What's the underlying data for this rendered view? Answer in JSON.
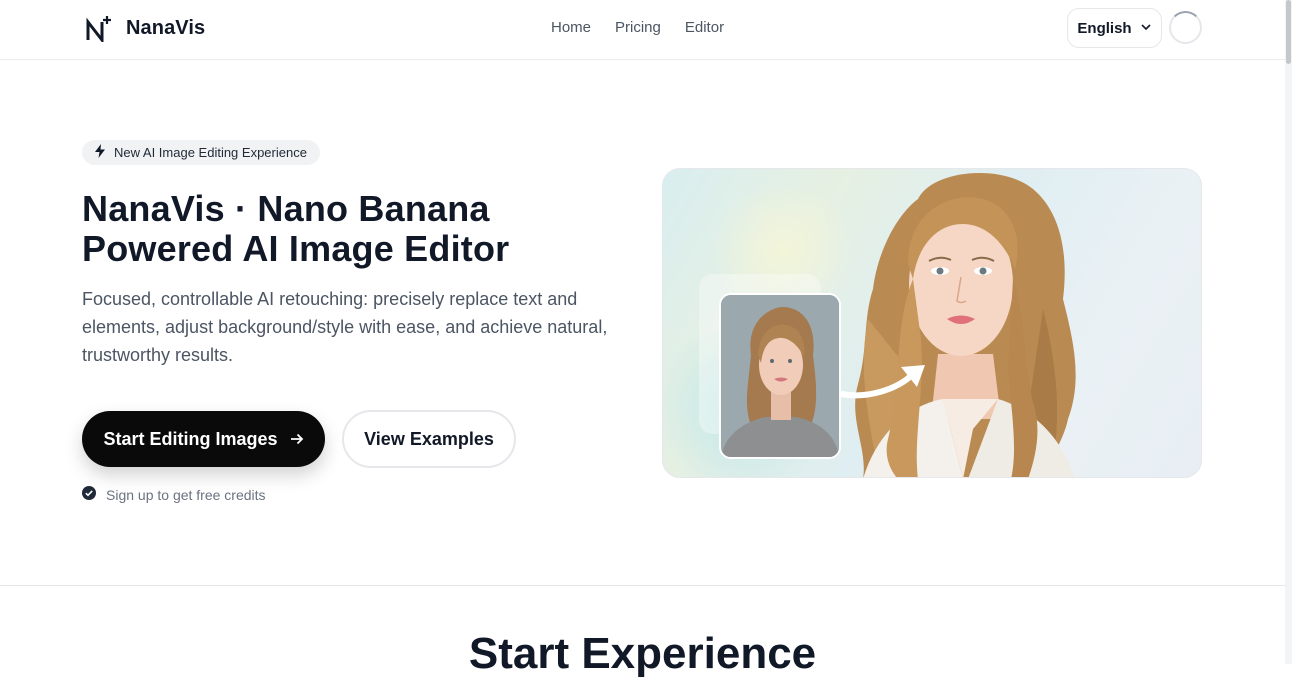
{
  "header": {
    "brand": "NanaVis",
    "nav": [
      {
        "label": "Home"
      },
      {
        "label": "Pricing"
      },
      {
        "label": "Editor"
      }
    ],
    "language": "English"
  },
  "hero": {
    "badge": "New AI Image Editing Experience",
    "title_line1": "NanaVis · Nano Banana",
    "title_line2": "Powered AI Image Editor",
    "description": "Focused, controllable AI retouching: precisely replace text and elements, adjust background/style with ease, and achieve natural, trustworthy results.",
    "primary_button": "Start Editing Images",
    "secondary_button": "View Examples",
    "note": "Sign up to get free credits"
  },
  "section": {
    "title": "Start Experience"
  },
  "colors": {
    "primary": "#0a0a0a",
    "text": "#111827",
    "muted": "#4b5563"
  }
}
